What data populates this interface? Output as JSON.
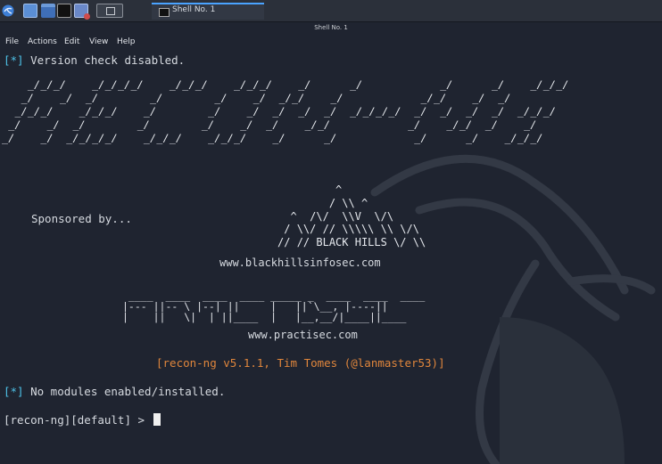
{
  "taskbar": {
    "launcher_icons": [
      "kali-menu-icon",
      "show-desktop-icon",
      "file-manager-icon",
      "terminal-icon",
      "app-icon"
    ],
    "window_label": "Shell No. 1"
  },
  "window": {
    "title": "Shell No. 1"
  },
  "menu": {
    "items": [
      "File",
      "Actions",
      "Edit",
      "View",
      "Help"
    ]
  },
  "terminal": {
    "line1": {
      "marker": "[*]",
      "text": " Version check disabled."
    },
    "banner_art": "    _/_/_/    _/_/_/_/    _/_/_/    _/_/_/    _/      _/            _/      _/    _/_/_/\n   _/    _/  _/        _/        _/    _/  _/_/    _/            _/_/    _/  _/\n  _/_/_/    _/_/_/    _/        _/    _/  _/  _/  _/  _/_/_/_/  _/  _/  _/  _/  _/_/_/\n _/    _/  _/        _/        _/    _/  _/    _/_/            _/    _/_/  _/    _/\n_/    _/  _/_/_/_/    _/_/_/    _/_/_/    _/      _/            _/      _/    _/_/_/",
    "sponsored": "Sponsored by...",
    "blackhills_art": "                  ^\n                 / \\\\ ^\n           ^  /\\/  \\\\V  \\/\\\n          / \\\\/ // \\\\\\\\\\ \\\\ \\/\\\n         // // BLACK HILLS \\/ \\\\\n",
    "blackhills_url": "www.blackhillsinfosec.com",
    "practisec_art": " ____  ____  ____  ____ _____ _  ____  ____  ____\n|--- ||-- \\ |--| ||     |   ||`\\__, |----||\n|    ||   \\|  | ||____  |   |__,__/|____||____",
    "practisec_url": "www.practisec.com",
    "version": "[recon-ng v5.1.1, Tim Tomes (@lanmaster53)]",
    "line2": {
      "marker": "[*]",
      "text": " No modules enabled/installed."
    },
    "prompt": "[recon-ng][default] > "
  },
  "colors": {
    "background": "#1f2430",
    "marker": "#4ec2e8",
    "version": "#e0863c",
    "text": "#d6dae0"
  }
}
